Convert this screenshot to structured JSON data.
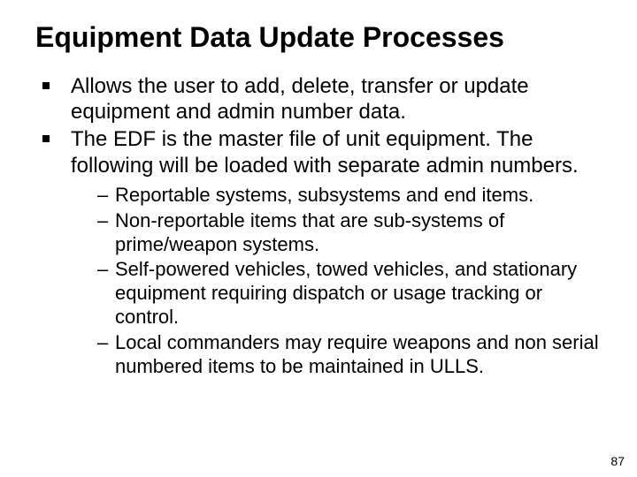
{
  "title": "Equipment Data Update Processes",
  "bullets": [
    "Allows the user to add, delete, transfer or update equipment and admin number data.",
    "The EDF is the master file of unit equipment. The following will be loaded with separate admin numbers."
  ],
  "sub_bullets": [
    "Reportable systems, subsystems and end items.",
    "Non-reportable items that are sub-systems of prime/weapon systems.",
    "Self-powered vehicles, towed vehicles, and stationary equipment requiring dispatch  or usage tracking or control.",
    "Local commanders may require weapons and non serial numbered items to be maintained in ULLS."
  ],
  "page_number": "87"
}
